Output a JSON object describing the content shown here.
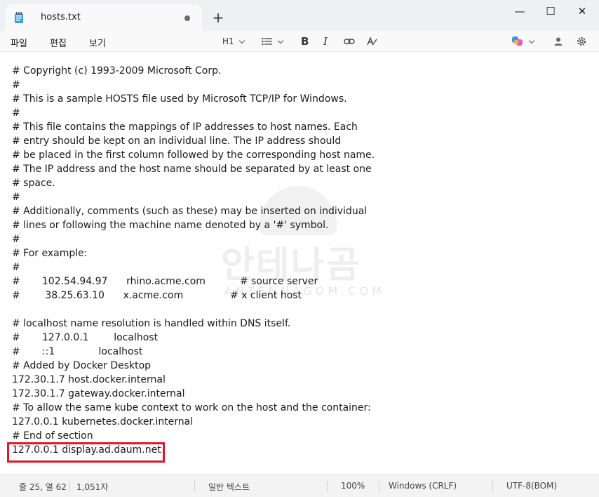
{
  "tab": {
    "title": "hosts.txt",
    "new_tab_symbol": "+"
  },
  "window_controls": {
    "minimize": "—",
    "maximize": "☐",
    "close": "✕"
  },
  "menu": {
    "file": "파일",
    "edit": "편집",
    "view": "보기"
  },
  "toolbar": {
    "heading": "H1",
    "bold": "B",
    "italic": "I"
  },
  "document": {
    "lines": [
      "# Copyright (c) 1993-2009 Microsoft Corp.",
      "#",
      "# This is a sample HOSTS file used by Microsoft TCP/IP for Windows.",
      "#",
      "# This file contains the mappings of IP addresses to host names. Each",
      "# entry should be kept on an individual line. The IP address should",
      "# be placed in the first column followed by the corresponding host name.",
      "# The IP address and the host name should be separated by at least one",
      "# space.",
      "#",
      "# Additionally, comments (such as these) may be inserted on individual",
      "# lines or following the machine name denoted by a '#' symbol.",
      "#",
      "# For example:",
      "#",
      "#       102.54.94.97      rhino.acme.com           # source server",
      "#        38.25.63.10      x.acme.com               # x client host",
      "",
      "# localhost name resolution is handled within DNS itself.",
      "#       127.0.0.1        localhost",
      "#       ::1              localhost",
      "# Added by Docker Desktop",
      "172.30.1.7 host.docker.internal",
      "172.30.1.7 gateway.docker.internal",
      "# To allow the same kube context to work on the host and the container:",
      "127.0.0.1 kubernetes.docker.internal",
      "# End of section",
      "127.0.0.1 display.ad.daum.net"
    ]
  },
  "watermark": {
    "text": "안테나곰",
    "sub": "ANTENNAGOM.COM"
  },
  "status": {
    "position": "줄 25, 열 62",
    "chars": "1,051자",
    "format": "일반 텍스트",
    "zoom": "100%",
    "line_ending": "Windows (CRLF)",
    "encoding": "UTF-8(BOM)"
  },
  "colors": {
    "highlight": "#e0162b",
    "titlebar": "#eef0f4"
  }
}
